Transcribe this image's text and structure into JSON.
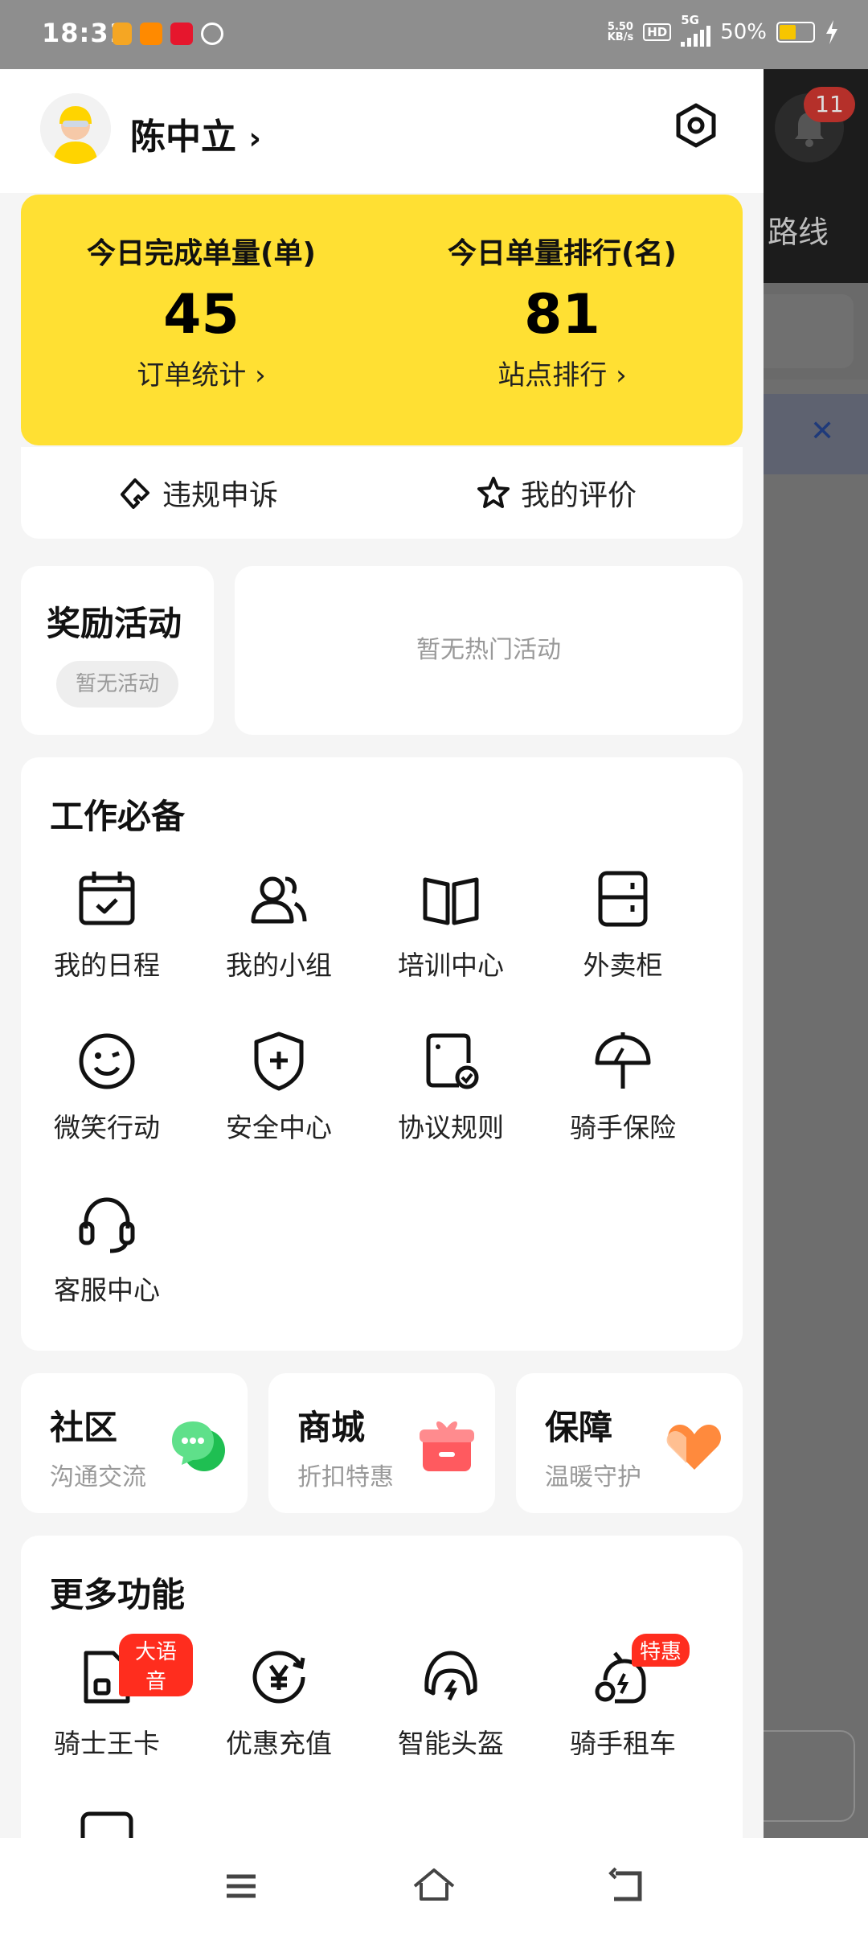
{
  "status_bar": {
    "time": "18:31",
    "net_speed_value": "5.50",
    "net_speed_unit": "KB/s",
    "hd_label": "HD",
    "network_type": "5G",
    "battery_percent": "50%",
    "battery_level": 0.5
  },
  "background": {
    "bell_badge": "11",
    "route_label": "路线"
  },
  "profile": {
    "name": "陈中立"
  },
  "stats": {
    "completed_label": "今日完成单量(单)",
    "completed_value": "45",
    "completed_link": "订单统计",
    "rank_label": "今日单量排行(名)",
    "rank_value": "81",
    "rank_link": "站点排行"
  },
  "sub_actions": {
    "appeal": "违规申诉",
    "rating": "我的评价"
  },
  "reward": {
    "title": "奖励活动",
    "chip": "暂无活动",
    "hot_empty": "暂无热门活动"
  },
  "work": {
    "title": "工作必备",
    "items": [
      {
        "label": "我的日程",
        "icon": "calendar-icon"
      },
      {
        "label": "我的小组",
        "icon": "group-icon"
      },
      {
        "label": "培训中心",
        "icon": "book-icon"
      },
      {
        "label": "外卖柜",
        "icon": "locker-icon"
      },
      {
        "label": "微笑行动",
        "icon": "smile-icon"
      },
      {
        "label": "安全中心",
        "icon": "shield-icon"
      },
      {
        "label": "协议规则",
        "icon": "document-check-icon"
      },
      {
        "label": "骑手保险",
        "icon": "umbrella-icon"
      },
      {
        "label": "客服中心",
        "icon": "headset-icon"
      }
    ]
  },
  "mini_cards": [
    {
      "title": "社区",
      "subtitle": "沟通交流",
      "icon": "chat-bubble-icon"
    },
    {
      "title": "商城",
      "subtitle": "折扣特惠",
      "icon": "gift-box-icon"
    },
    {
      "title": "保障",
      "subtitle": "温暖守护",
      "icon": "heart-icon"
    }
  ],
  "more": {
    "title": "更多功能",
    "items": [
      {
        "label": "骑士王卡",
        "tag": "大语音",
        "icon": "sim-card-icon"
      },
      {
        "label": "优惠充值",
        "tag": "",
        "icon": "yen-recharge-icon"
      },
      {
        "label": "智能头盔",
        "tag": "",
        "icon": "helmet-icon"
      },
      {
        "label": "骑手租车",
        "tag": "特惠",
        "icon": "scooter-icon"
      }
    ]
  },
  "colors": {
    "accent_yellow": "#ffe033",
    "tag_red": "#ff2d1e",
    "chat_green": "#2fcf62",
    "gift_red": "#ff5a5f",
    "heart_orange": "#ff8a3d"
  }
}
